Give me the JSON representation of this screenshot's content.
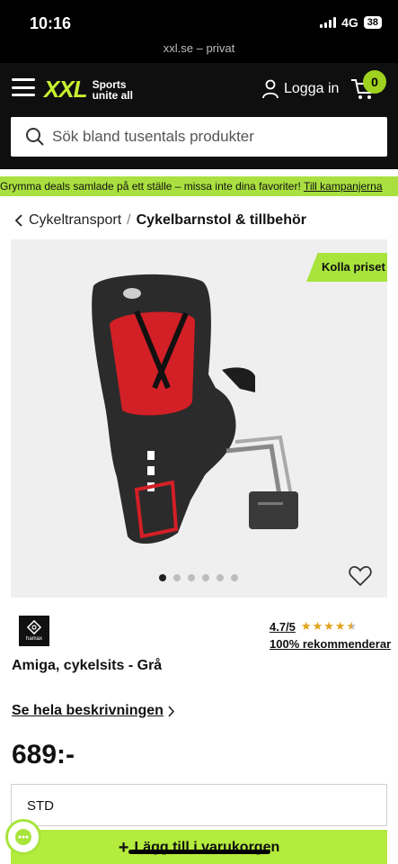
{
  "status": {
    "time": "10:16",
    "network": "4G",
    "battery": "38"
  },
  "browser": {
    "url": "xxl.se",
    "mode": "– privat"
  },
  "header": {
    "logo_text": "XXL",
    "logo_tagline_1": "Sports",
    "logo_tagline_2": "unite all",
    "login_label": "Logga in",
    "cart_count": "0",
    "accent_color": "#c7f030"
  },
  "search": {
    "placeholder": "Sök bland tusentals produkter"
  },
  "promo": {
    "text": "Grymma deals samlade på ett ställe – missa inte dina favoriter!",
    "link": "Till kampanjerna"
  },
  "breadcrumb": {
    "parent": "Cykeltransport",
    "separator": "/",
    "current": "Cykelbarnstol & tillbehör"
  },
  "gallery": {
    "badge": "Kolla priset",
    "image_count": 6,
    "active_index": 0
  },
  "product": {
    "brand": "hamax",
    "rating": "4.7/5",
    "stars": 4.5,
    "recommend": "100% rekommenderar",
    "title": "Amiga, cykelsits - Grå",
    "description_link": "Se hela beskrivningen",
    "price": "689:-",
    "variant": "STD",
    "add_to_cart": "Lägg till i varukorgen"
  }
}
